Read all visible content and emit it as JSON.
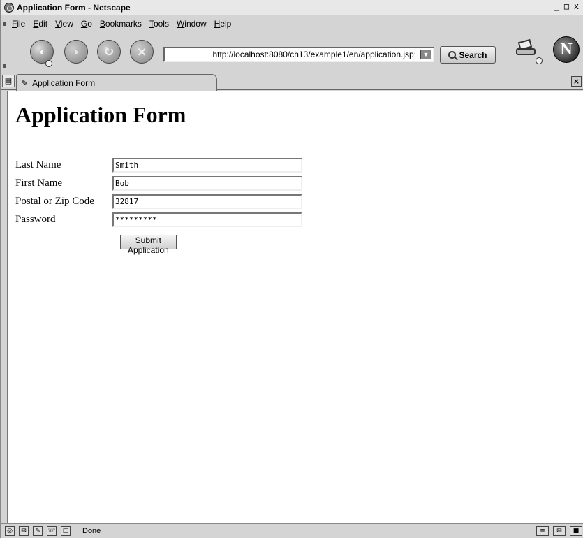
{
  "window": {
    "title": "Application Form - Netscape",
    "controls": [
      "_",
      "□",
      "x"
    ]
  },
  "menubar": {
    "items": [
      "File",
      "Edit",
      "View",
      "Go",
      "Bookmarks",
      "Tools",
      "Window",
      "Help"
    ]
  },
  "toolbar": {
    "back_icon": "back-arrow-icon",
    "forward_icon": "forward-arrow-icon",
    "reload_icon": "reload-icon",
    "stop_icon": "stop-icon",
    "url": "http://localhost:8080/ch13/example1/en/application.jsp;",
    "search_label": "Search",
    "throbber_letter": "N"
  },
  "tabs": [
    {
      "label": "Application Form"
    }
  ],
  "page": {
    "heading": "Application Form",
    "fields": [
      {
        "label": "Last Name",
        "value": "Smith"
      },
      {
        "label": "First Name",
        "value": "Bob"
      },
      {
        "label": "Postal or Zip Code",
        "value": "32817"
      },
      {
        "label": "Password",
        "value": "*********"
      }
    ],
    "submit_label": "Submit Application"
  },
  "statusbar": {
    "text": "Done"
  }
}
